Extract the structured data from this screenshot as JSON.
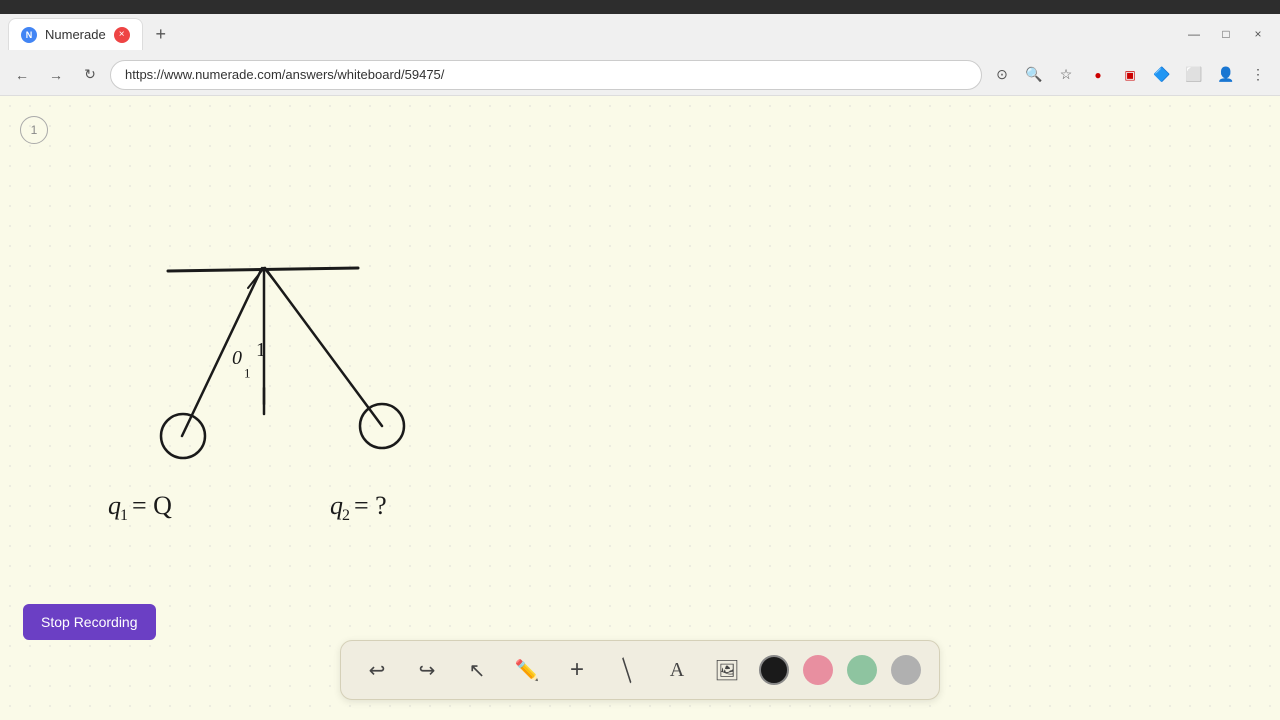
{
  "browser": {
    "chrome_color": "#2d2d2d",
    "tab": {
      "favicon_text": "N",
      "title": "Numerade",
      "close_label": "×",
      "new_tab_label": "+"
    },
    "window_controls": {
      "minimize": "—",
      "maximize": "□",
      "close": "×"
    },
    "nav": {
      "back": "←",
      "forward": "→",
      "refresh": "↻"
    },
    "address": "https://www.numerade.com/answers/whiteboard/59475/",
    "icons": [
      "⊙",
      "🔍",
      "☆",
      "👤",
      "⋮"
    ]
  },
  "whiteboard": {
    "page_number": "1",
    "background_color": "#fafae8"
  },
  "toolbar": {
    "undo_label": "↩",
    "redo_label": "↪",
    "select_label": "↖",
    "pen_label": "✏",
    "plus_label": "+",
    "eraser_label": "/",
    "text_label": "A",
    "image_label": "🖼",
    "colors": [
      {
        "name": "black",
        "hex": "#1a1a1a",
        "selected": true
      },
      {
        "name": "pink",
        "hex": "#e88fa0",
        "selected": false
      },
      {
        "name": "green",
        "hex": "#8ec4a0",
        "selected": false
      },
      {
        "name": "gray",
        "hex": "#b0b0b0",
        "selected": false
      }
    ]
  },
  "stop_recording": {
    "label": "Stop Recording",
    "bg_color": "#6b3fc4"
  }
}
